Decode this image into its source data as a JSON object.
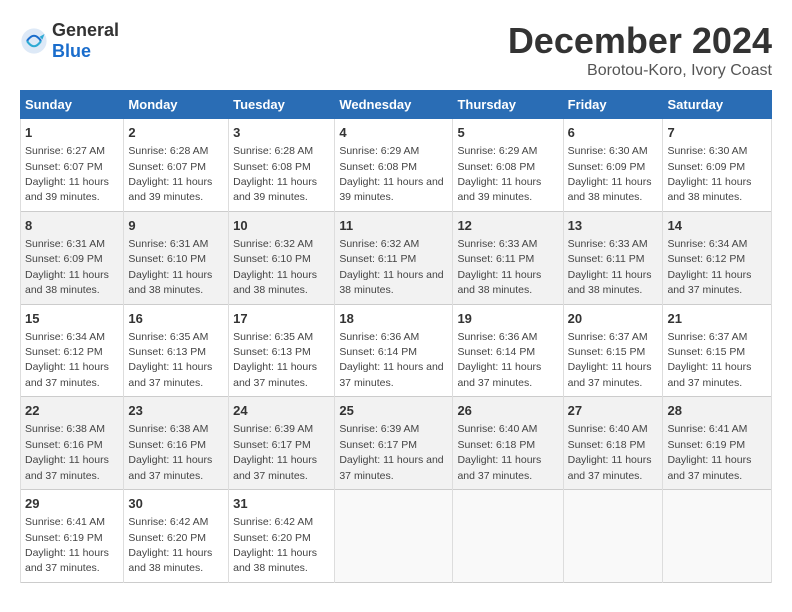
{
  "header": {
    "logo_general": "General",
    "logo_blue": "Blue",
    "month": "December 2024",
    "location": "Borotou-Koro, Ivory Coast"
  },
  "days_of_week": [
    "Sunday",
    "Monday",
    "Tuesday",
    "Wednesday",
    "Thursday",
    "Friday",
    "Saturday"
  ],
  "weeks": [
    [
      {
        "day": 1,
        "sunrise": "Sunrise: 6:27 AM",
        "sunset": "Sunset: 6:07 PM",
        "daylight": "Daylight: 11 hours and 39 minutes."
      },
      {
        "day": 2,
        "sunrise": "Sunrise: 6:28 AM",
        "sunset": "Sunset: 6:07 PM",
        "daylight": "Daylight: 11 hours and 39 minutes."
      },
      {
        "day": 3,
        "sunrise": "Sunrise: 6:28 AM",
        "sunset": "Sunset: 6:08 PM",
        "daylight": "Daylight: 11 hours and 39 minutes."
      },
      {
        "day": 4,
        "sunrise": "Sunrise: 6:29 AM",
        "sunset": "Sunset: 6:08 PM",
        "daylight": "Daylight: 11 hours and 39 minutes."
      },
      {
        "day": 5,
        "sunrise": "Sunrise: 6:29 AM",
        "sunset": "Sunset: 6:08 PM",
        "daylight": "Daylight: 11 hours and 39 minutes."
      },
      {
        "day": 6,
        "sunrise": "Sunrise: 6:30 AM",
        "sunset": "Sunset: 6:09 PM",
        "daylight": "Daylight: 11 hours and 38 minutes."
      },
      {
        "day": 7,
        "sunrise": "Sunrise: 6:30 AM",
        "sunset": "Sunset: 6:09 PM",
        "daylight": "Daylight: 11 hours and 38 minutes."
      }
    ],
    [
      {
        "day": 8,
        "sunrise": "Sunrise: 6:31 AM",
        "sunset": "Sunset: 6:09 PM",
        "daylight": "Daylight: 11 hours and 38 minutes."
      },
      {
        "day": 9,
        "sunrise": "Sunrise: 6:31 AM",
        "sunset": "Sunset: 6:10 PM",
        "daylight": "Daylight: 11 hours and 38 minutes."
      },
      {
        "day": 10,
        "sunrise": "Sunrise: 6:32 AM",
        "sunset": "Sunset: 6:10 PM",
        "daylight": "Daylight: 11 hours and 38 minutes."
      },
      {
        "day": 11,
        "sunrise": "Sunrise: 6:32 AM",
        "sunset": "Sunset: 6:11 PM",
        "daylight": "Daylight: 11 hours and 38 minutes."
      },
      {
        "day": 12,
        "sunrise": "Sunrise: 6:33 AM",
        "sunset": "Sunset: 6:11 PM",
        "daylight": "Daylight: 11 hours and 38 minutes."
      },
      {
        "day": 13,
        "sunrise": "Sunrise: 6:33 AM",
        "sunset": "Sunset: 6:11 PM",
        "daylight": "Daylight: 11 hours and 38 minutes."
      },
      {
        "day": 14,
        "sunrise": "Sunrise: 6:34 AM",
        "sunset": "Sunset: 6:12 PM",
        "daylight": "Daylight: 11 hours and 37 minutes."
      }
    ],
    [
      {
        "day": 15,
        "sunrise": "Sunrise: 6:34 AM",
        "sunset": "Sunset: 6:12 PM",
        "daylight": "Daylight: 11 hours and 37 minutes."
      },
      {
        "day": 16,
        "sunrise": "Sunrise: 6:35 AM",
        "sunset": "Sunset: 6:13 PM",
        "daylight": "Daylight: 11 hours and 37 minutes."
      },
      {
        "day": 17,
        "sunrise": "Sunrise: 6:35 AM",
        "sunset": "Sunset: 6:13 PM",
        "daylight": "Daylight: 11 hours and 37 minutes."
      },
      {
        "day": 18,
        "sunrise": "Sunrise: 6:36 AM",
        "sunset": "Sunset: 6:14 PM",
        "daylight": "Daylight: 11 hours and 37 minutes."
      },
      {
        "day": 19,
        "sunrise": "Sunrise: 6:36 AM",
        "sunset": "Sunset: 6:14 PM",
        "daylight": "Daylight: 11 hours and 37 minutes."
      },
      {
        "day": 20,
        "sunrise": "Sunrise: 6:37 AM",
        "sunset": "Sunset: 6:15 PM",
        "daylight": "Daylight: 11 hours and 37 minutes."
      },
      {
        "day": 21,
        "sunrise": "Sunrise: 6:37 AM",
        "sunset": "Sunset: 6:15 PM",
        "daylight": "Daylight: 11 hours and 37 minutes."
      }
    ],
    [
      {
        "day": 22,
        "sunrise": "Sunrise: 6:38 AM",
        "sunset": "Sunset: 6:16 PM",
        "daylight": "Daylight: 11 hours and 37 minutes."
      },
      {
        "day": 23,
        "sunrise": "Sunrise: 6:38 AM",
        "sunset": "Sunset: 6:16 PM",
        "daylight": "Daylight: 11 hours and 37 minutes."
      },
      {
        "day": 24,
        "sunrise": "Sunrise: 6:39 AM",
        "sunset": "Sunset: 6:17 PM",
        "daylight": "Daylight: 11 hours and 37 minutes."
      },
      {
        "day": 25,
        "sunrise": "Sunrise: 6:39 AM",
        "sunset": "Sunset: 6:17 PM",
        "daylight": "Daylight: 11 hours and 37 minutes."
      },
      {
        "day": 26,
        "sunrise": "Sunrise: 6:40 AM",
        "sunset": "Sunset: 6:18 PM",
        "daylight": "Daylight: 11 hours and 37 minutes."
      },
      {
        "day": 27,
        "sunrise": "Sunrise: 6:40 AM",
        "sunset": "Sunset: 6:18 PM",
        "daylight": "Daylight: 11 hours and 37 minutes."
      },
      {
        "day": 28,
        "sunrise": "Sunrise: 6:41 AM",
        "sunset": "Sunset: 6:19 PM",
        "daylight": "Daylight: 11 hours and 37 minutes."
      }
    ],
    [
      {
        "day": 29,
        "sunrise": "Sunrise: 6:41 AM",
        "sunset": "Sunset: 6:19 PM",
        "daylight": "Daylight: 11 hours and 37 minutes."
      },
      {
        "day": 30,
        "sunrise": "Sunrise: 6:42 AM",
        "sunset": "Sunset: 6:20 PM",
        "daylight": "Daylight: 11 hours and 38 minutes."
      },
      {
        "day": 31,
        "sunrise": "Sunrise: 6:42 AM",
        "sunset": "Sunset: 6:20 PM",
        "daylight": "Daylight: 11 hours and 38 minutes."
      },
      null,
      null,
      null,
      null
    ]
  ]
}
